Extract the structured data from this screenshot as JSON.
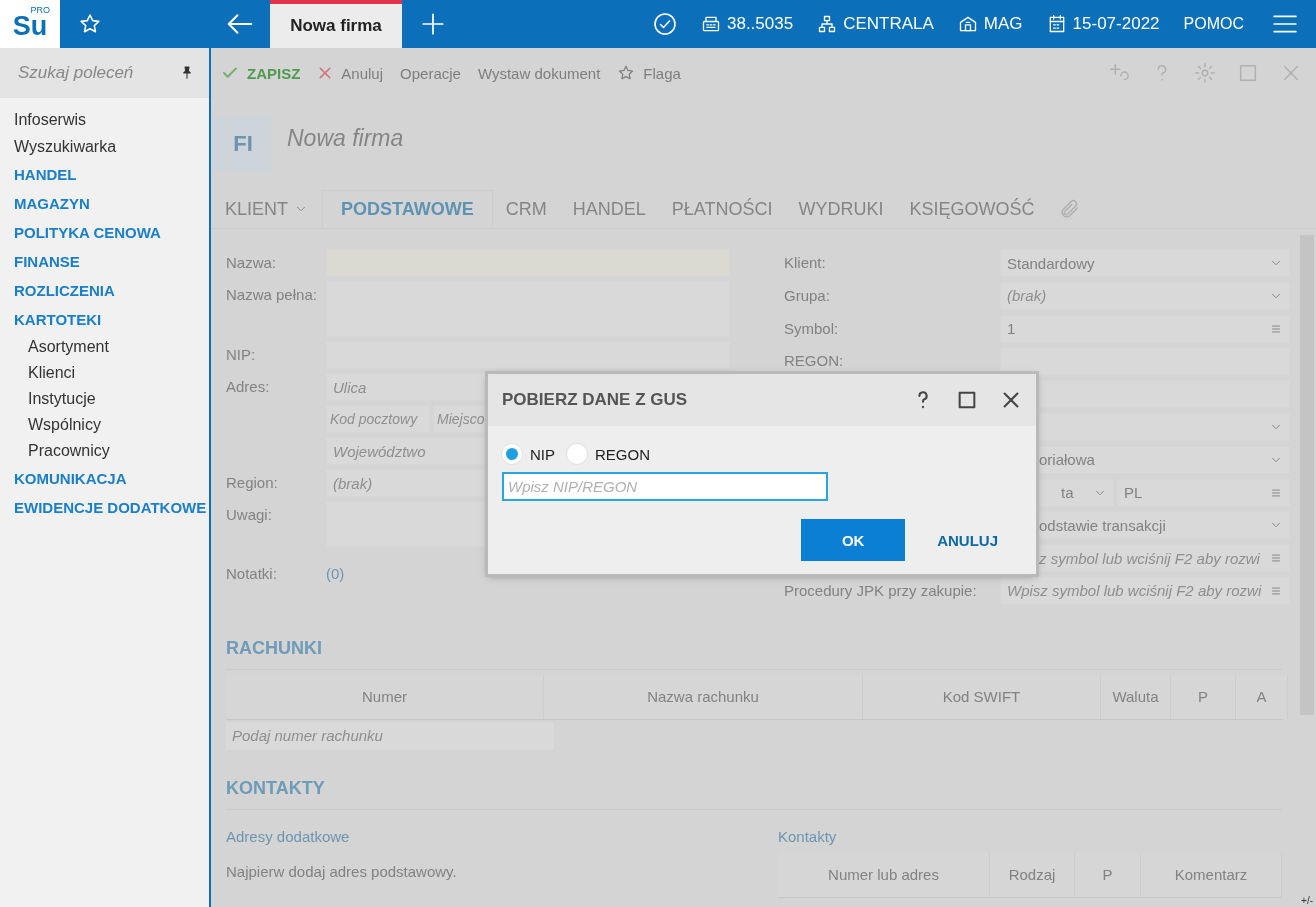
{
  "header": {
    "logo": "Su",
    "logo_badge": "PRO",
    "tabs": [
      {
        "label": "Nowa firma",
        "selected": true
      }
    ],
    "status": [
      {
        "kind": "register",
        "label": "38..5035"
      },
      {
        "kind": "branch",
        "label": "CENTRALA"
      },
      {
        "kind": "warehouse",
        "label": "MAG"
      },
      {
        "kind": "date",
        "label": "15-07-2022"
      }
    ],
    "help": "POMOC"
  },
  "sidebar": {
    "search_placeholder": "Szukaj poleceń",
    "items": [
      {
        "label": "Infoserwis",
        "kind": "link"
      },
      {
        "label": "Wyszukiwarka",
        "kind": "link"
      },
      {
        "label": "HANDEL",
        "kind": "module"
      },
      {
        "label": "MAGAZYN",
        "kind": "module"
      },
      {
        "label": "POLITYKA CENOWA",
        "kind": "module"
      },
      {
        "label": "FINANSE",
        "kind": "module"
      },
      {
        "label": "ROZLICZENIA",
        "kind": "module"
      },
      {
        "label": "KARTOTEKI",
        "kind": "module",
        "children": [
          {
            "label": "Asortyment"
          },
          {
            "label": "Klienci"
          },
          {
            "label": "Instytucje"
          },
          {
            "label": "Wspólnicy"
          },
          {
            "label": "Pracownicy"
          }
        ]
      },
      {
        "label": "KOMUNIKACJA",
        "kind": "module"
      },
      {
        "label": "EWIDENCJE DODATKOWE",
        "kind": "module"
      }
    ]
  },
  "toolbar": {
    "actions": [
      {
        "label": "ZAPISZ",
        "kind": "save"
      },
      {
        "label": "Anuluj",
        "kind": "cancel"
      },
      {
        "label": "Operacje",
        "kind": "plain"
      },
      {
        "label": "Wystaw dokument",
        "kind": "plain"
      },
      {
        "label": "Flaga",
        "kind": "flag"
      }
    ]
  },
  "record": {
    "badge": "FI",
    "title": "Nowa firma"
  },
  "tabs": {
    "dropdown": "KLIENT",
    "items": [
      {
        "label": "PODSTAWOWE",
        "selected": true
      },
      {
        "label": "CRM",
        "selected": false
      },
      {
        "label": "HANDEL",
        "selected": false
      },
      {
        "label": "PŁATNOŚCI",
        "selected": false
      },
      {
        "label": "WYDRUKI",
        "selected": false
      },
      {
        "label": "KSIĘGOWOŚĆ",
        "selected": false
      }
    ]
  },
  "form_left": [
    {
      "label": "Nazwa:",
      "kind": "required"
    },
    {
      "label": "Nazwa pełna:",
      "kind": "tall"
    },
    {
      "label": "NIP:",
      "kind": "text"
    },
    {
      "label": "Adres:",
      "kind": "text",
      "placeholder": "Ulica"
    },
    {
      "kind": "split",
      "parts": [
        {
          "placeholder": "Kod pocztowy"
        },
        {
          "placeholder": "Miejsco"
        }
      ]
    },
    {
      "kind": "text",
      "placeholder": "Województwo"
    },
    {
      "label": "Region:",
      "kind": "text",
      "placeholder": "(brak)"
    },
    {
      "label": "Uwagi:",
      "kind": "notes"
    },
    {
      "label": "Notatki:",
      "kind": "link",
      "value": "(0)"
    }
  ],
  "form_right": [
    {
      "label": "Klient:",
      "kind": "select",
      "value": "Standardowy"
    },
    {
      "label": "Grupa:",
      "kind": "select",
      "placeholder": "(brak)"
    },
    {
      "label": "Symbol:",
      "kind": "lookup",
      "value": "1"
    },
    {
      "label": "REGON:",
      "kind": "text"
    },
    {
      "kind": "text"
    },
    {
      "kind": "select"
    },
    {
      "kind": "select",
      "value": "oriałowa"
    },
    {
      "kind": "split",
      "parts": [
        {
          "kind": "select",
          "value": "ta"
        },
        {
          "kind": "lookup",
          "value": "PL"
        }
      ]
    },
    {
      "kind": "select",
      "value": "odstawie transakcji"
    },
    {
      "kind": "lookup",
      "placeholder": "z symbol lub wciśnij F2 aby rozwi"
    },
    {
      "label": "Procedury JPK przy zakupie:",
      "kind": "lookup",
      "placeholder": "Wpisz symbol lub wciśnij F2 aby rozwi"
    }
  ],
  "accounts": {
    "title": "RACHUNKI",
    "columns": [
      "Numer",
      "Nazwa rachunku",
      "Kod SWIFT",
      "Waluta",
      "P",
      "A"
    ],
    "placeholder": "Podaj numer rachunku"
  },
  "contacts": {
    "title": "KONTAKTY",
    "addresses_title": "Adresy dodatkowe",
    "addresses_note": "Najpierw dodaj adres podstawowy.",
    "contacts_title": "Kontakty",
    "columns": [
      "Numer lub adres",
      "Rodzaj",
      "P",
      "Komentarz"
    ]
  },
  "corner": "+/-",
  "dialog": {
    "title": "POBIERZ DANE Z GUS",
    "options": [
      {
        "label": "NIP",
        "selected": true
      },
      {
        "label": "REGON",
        "selected": false
      }
    ],
    "placeholder": "Wpisz NIP/REGON",
    "buttons": [
      {
        "label": "OK",
        "kind": "primary"
      },
      {
        "label": "ANULUJ",
        "kind": "text"
      }
    ]
  }
}
